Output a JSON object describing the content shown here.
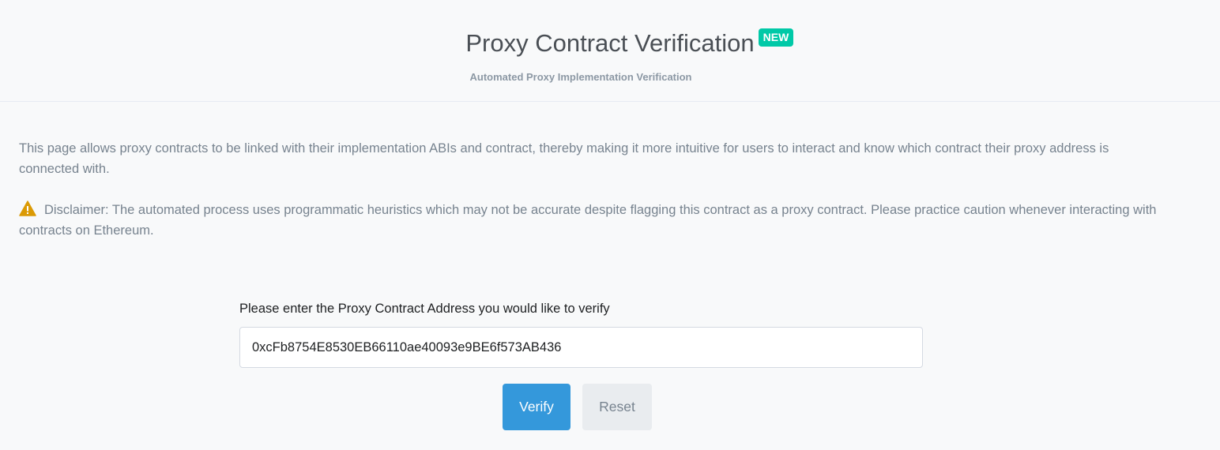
{
  "header": {
    "title": "Proxy Contract Verification",
    "badge": "NEW",
    "subtitle": "Automated Proxy Implementation Verification"
  },
  "intro": {
    "text": "This page allows proxy contracts to be linked with their implementation ABIs and contract, thereby making it more intuitive for users to interact and know which contract their proxy address is connected with."
  },
  "disclaimer": {
    "icon": "warning-icon",
    "text": "Disclaimer: The automated process uses programmatic heuristics which may not be accurate despite flagging this contract as a proxy contract. Please practice caution whenever interacting with contracts on Ethereum."
  },
  "form": {
    "label": "Please enter the Proxy Contract Address you would like to verify",
    "address_value": "0xcFb8754E8530EB66110ae40093e9BE6f573AB436",
    "verify_label": "Verify",
    "reset_label": "Reset"
  },
  "colors": {
    "badge": "#00c9a7",
    "primary": "#3498db",
    "warning": "#db9a04"
  }
}
